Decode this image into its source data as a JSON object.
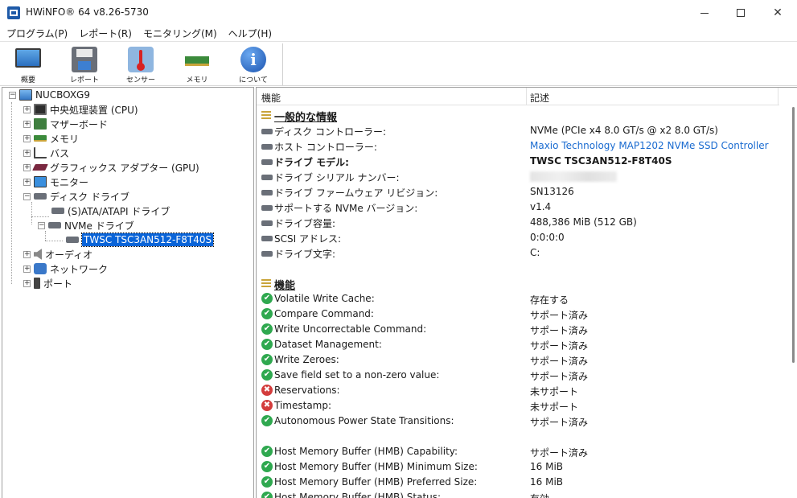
{
  "window": {
    "title": "HWiNFO® 64 v8.26-5730",
    "min_glyph": "",
    "max_glyph": "",
    "close_glyph": "✕"
  },
  "menu": [
    "プログラム(P)",
    "レポート(R)",
    "モニタリング(M)",
    "ヘルプ(H)"
  ],
  "toolbar": {
    "buttons": [
      {
        "label": "概要",
        "icon": "monitor-icon"
      },
      {
        "label": "レポート",
        "icon": "floppy-icon"
      },
      {
        "label": "センサー",
        "icon": "thermometer-icon"
      },
      {
        "label": "メモリ",
        "icon": "ram-icon"
      },
      {
        "label": "について",
        "icon": "info-icon"
      }
    ],
    "info_glyph": "i"
  },
  "tree": {
    "root": "NUCBOXG9",
    "items": [
      {
        "label": "中央処理装置 (CPU)",
        "expander": "+",
        "icon": "cpu-icon"
      },
      {
        "label": "マザーボード",
        "expander": "+",
        "icon": "motherboard-icon"
      },
      {
        "label": "メモリ",
        "expander": "+",
        "icon": "ram-icon"
      },
      {
        "label": "バス",
        "expander": "+",
        "icon": "bus-icon"
      },
      {
        "label": "グラフィックス アダプター (GPU)",
        "expander": "+",
        "icon": "gpu-icon"
      },
      {
        "label": "モニター",
        "expander": "+",
        "icon": "monitor-icon"
      },
      {
        "label": "ディスク ドライブ",
        "expander": "−",
        "icon": "disk-icon"
      },
      {
        "label": "(S)ATA/ATAPI ドライブ",
        "icon": "disk-icon"
      },
      {
        "label": "NVMe ドライブ",
        "expander": "−",
        "icon": "disk-icon"
      },
      {
        "label": "TWSC TSC3AN512-F8T40S",
        "icon": "disk-icon",
        "selected": true
      },
      {
        "label": "オーディオ",
        "expander": "+",
        "icon": "audio-icon"
      },
      {
        "label": "ネットワーク",
        "expander": "+",
        "icon": "network-icon"
      },
      {
        "label": "ポート",
        "expander": "+",
        "icon": "port-icon"
      }
    ],
    "root_expander": "−"
  },
  "details": {
    "columns": [
      "機能",
      "記述"
    ],
    "general_section": "一般的な情報",
    "features_section": "機能",
    "ok_glyph": "✔",
    "no_glyph": "✖",
    "general": [
      {
        "label": "ディスク コントローラー:",
        "value": "NVMe (PCIe x4 8.0 GT/s @ x2 8.0 GT/s)"
      },
      {
        "label": "ホスト コントローラー:",
        "value": "Maxio Technology MAP1202 NVMe SSD Controller",
        "style": "link"
      },
      {
        "label": "ドライブ モデル:",
        "value": "TWSC TSC3AN512-F8T40S",
        "style": "bold"
      },
      {
        "label": "ドライブ シリアル ナンバー:",
        "value": "",
        "style": "blurred"
      },
      {
        "label": "ドライブ ファームウェア リビジョン:",
        "value": "SN13126"
      },
      {
        "label": "サポートする NVMe バージョン:",
        "value": "v1.4"
      },
      {
        "label": "ドライブ容量:",
        "value": "488,386 MiB (512 GB)"
      },
      {
        "label": "SCSI アドレス:",
        "value": "0:0:0:0"
      },
      {
        "label": "ドライブ文字:",
        "value": "C:"
      }
    ],
    "features": [
      {
        "label": "Volatile Write Cache:",
        "value": "存在する",
        "status": "ok"
      },
      {
        "label": "Compare Command:",
        "value": "サポート済み",
        "status": "ok"
      },
      {
        "label": "Write Uncorrectable Command:",
        "value": "サポート済み",
        "status": "ok"
      },
      {
        "label": "Dataset Management:",
        "value": "サポート済み",
        "status": "ok"
      },
      {
        "label": "Write Zeroes:",
        "value": "サポート済み",
        "status": "ok"
      },
      {
        "label": "Save field set to a non-zero value:",
        "value": "サポート済み",
        "status": "ok"
      },
      {
        "label": "Reservations:",
        "value": "未サポート",
        "status": "no"
      },
      {
        "label": "Timestamp:",
        "value": "未サポート",
        "status": "no"
      },
      {
        "label": "Autonomous Power State Transitions:",
        "value": "サポート済み",
        "status": "ok"
      }
    ],
    "hmb": [
      {
        "label": "Host Memory Buffer (HMB) Capability:",
        "value": "サポート済み",
        "status": "ok"
      },
      {
        "label": "Host Memory Buffer (HMB) Minimum Size:",
        "value": "16 MiB",
        "status": "ok"
      },
      {
        "label": "Host Memory Buffer (HMB) Preferred Size:",
        "value": "16 MiB",
        "status": "ok"
      },
      {
        "label": "Host Memory Buffer (HMB) Status:",
        "value": "有効",
        "status": "ok"
      }
    ]
  },
  "colors": {
    "selection": "#0a64d8",
    "link": "#1a6bd0",
    "ok": "#2fa84f",
    "error": "#d33c3c"
  }
}
